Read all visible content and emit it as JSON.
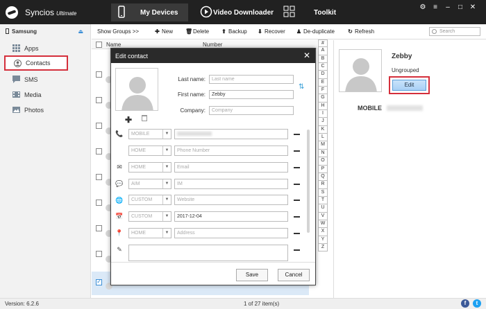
{
  "app": {
    "name": "Syncios",
    "edition": "Ultimate"
  },
  "nav": {
    "my_devices": "My Devices",
    "video_downloader": "Video Downloader",
    "toolkit": "Toolkit"
  },
  "window": {
    "settings": "⚙",
    "menu": "≡",
    "minimize": "–",
    "maximize": "□",
    "close": "✕"
  },
  "sidebar": {
    "device": "Samsung",
    "items": [
      {
        "label": "Apps",
        "icon": "apps-icon"
      },
      {
        "label": "Contacts",
        "icon": "contact-icon"
      },
      {
        "label": "SMS",
        "icon": "sms-icon"
      },
      {
        "label": "Media",
        "icon": "media-icon"
      },
      {
        "label": "Photos",
        "icon": "photos-icon"
      }
    ]
  },
  "toolbar": {
    "show_groups": "Show Groups >>",
    "new": "New",
    "delete": "Delete",
    "backup": "Backup",
    "recover": "Recover",
    "dedupe": "De-duplicate",
    "refresh": "Refresh",
    "search_placeholder": "Search"
  },
  "list": {
    "col_name": "Name",
    "col_number": "Number"
  },
  "alphabet": [
    "#",
    "A",
    "B",
    "C",
    "D",
    "E",
    "F",
    "G",
    "H",
    "I",
    "J",
    "K",
    "L",
    "M",
    "N",
    "O",
    "P",
    "Q",
    "R",
    "S",
    "T",
    "U",
    "V",
    "W",
    "X",
    "Y",
    "Z"
  ],
  "detail": {
    "name": "Zebby",
    "group": "Ungrouped",
    "edit": "Edit",
    "phone_type": "MOBILE"
  },
  "dialog": {
    "title": "Edit contact",
    "last_name_label": "Last name:",
    "last_name_placeholder": "Last name",
    "first_name_label": "First name:",
    "first_name_value": "Zebby",
    "company_label": "Company:",
    "company_placeholder": "Company",
    "rows": [
      {
        "type": "MOBILE",
        "value": ""
      },
      {
        "type": "HOME",
        "value": "Phone Number"
      },
      {
        "type": "HOME",
        "value": "Email"
      },
      {
        "type": "AIM",
        "value": "IM"
      },
      {
        "type": "CUSTOM",
        "value": "Website"
      },
      {
        "type": "CUSTOM",
        "value": "2017-12-04"
      },
      {
        "type": "HOME",
        "value": "Address"
      }
    ],
    "save": "Save",
    "cancel": "Cancel"
  },
  "status": {
    "version": "Version: 6.2.6",
    "items": "1 of 27 item(s)"
  }
}
